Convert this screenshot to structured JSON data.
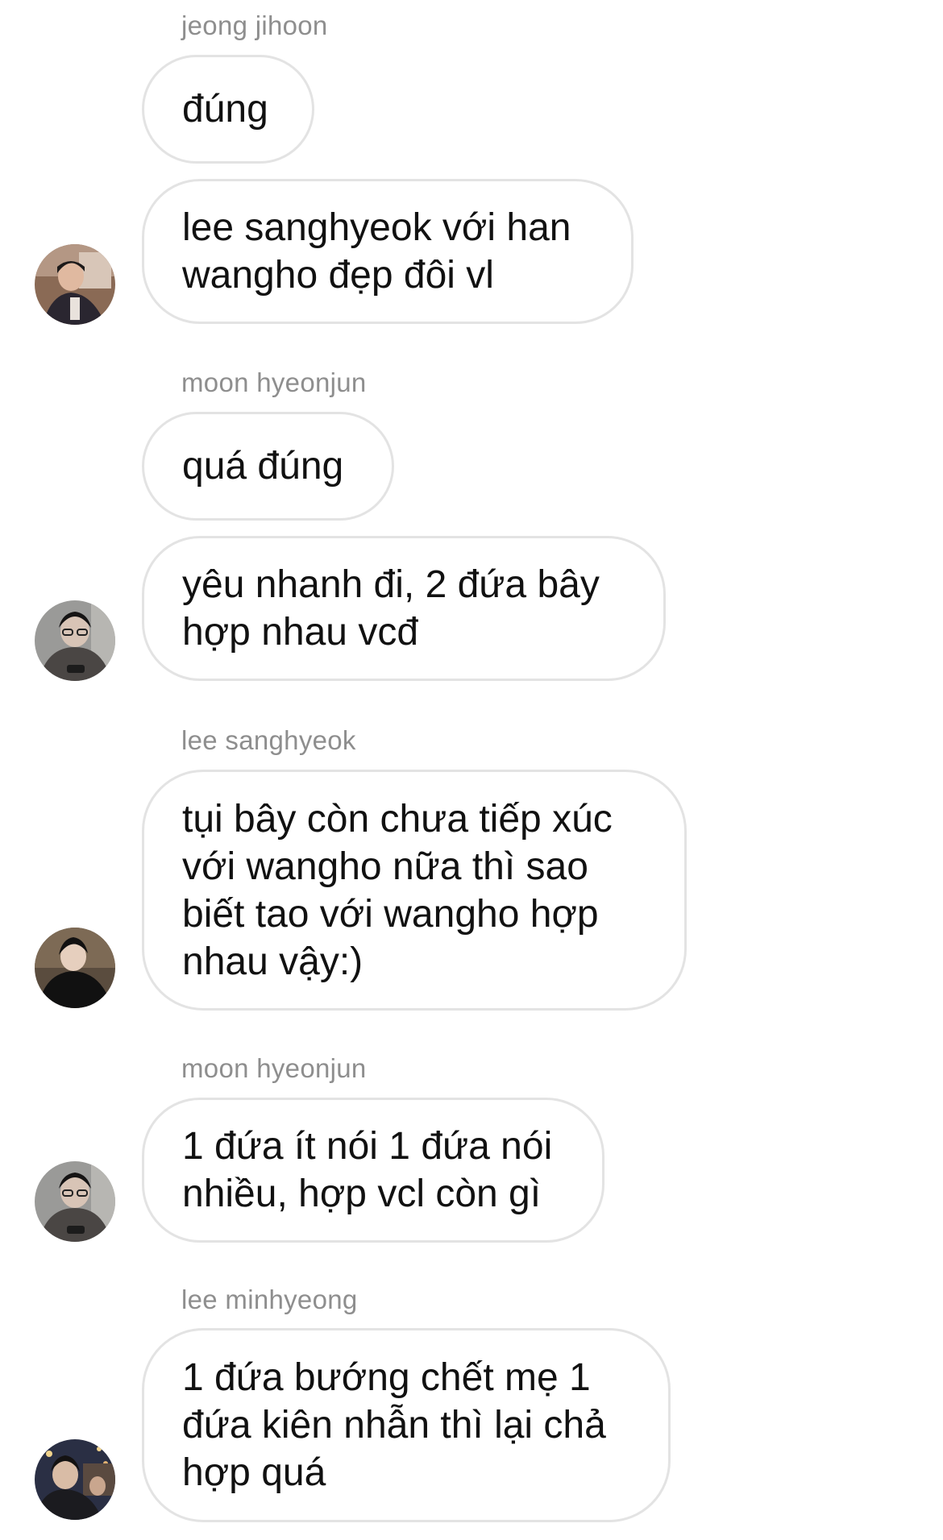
{
  "messages": [
    {
      "sender": "jeong jihoon",
      "texts": [
        "đúng",
        "lee sanghyeok với han\nwangho đẹp đôi vl"
      ]
    },
    {
      "sender": "moon hyeonjun",
      "texts": [
        "quá đúng",
        "yêu nhanh đi, 2 đứa bây\nhợp nhau vcđ"
      ]
    },
    {
      "sender": "lee sanghyeok",
      "texts": [
        "tụi bây còn chưa tiếp xúc\nvới wangho nữa thì sao\nbiết tao với wangho hợp\nnhau vậy:)"
      ]
    },
    {
      "sender": "moon hyeonjun",
      "texts": [
        "1 đứa ít nói 1 đứa nói\nnhiều, hợp vcl còn gì"
      ]
    },
    {
      "sender": "lee minhyeong",
      "texts": [
        "1 đứa bướng chết mẹ 1\nđứa kiên nhẫn thì lại chả\nhợp quá"
      ]
    }
  ],
  "colors": {
    "bubble_border": "#e3e3e3",
    "sender_text": "#8e8e8e",
    "message_text": "#111111",
    "background": "#ffffff"
  },
  "icons": [
    "avatar-photo"
  ]
}
